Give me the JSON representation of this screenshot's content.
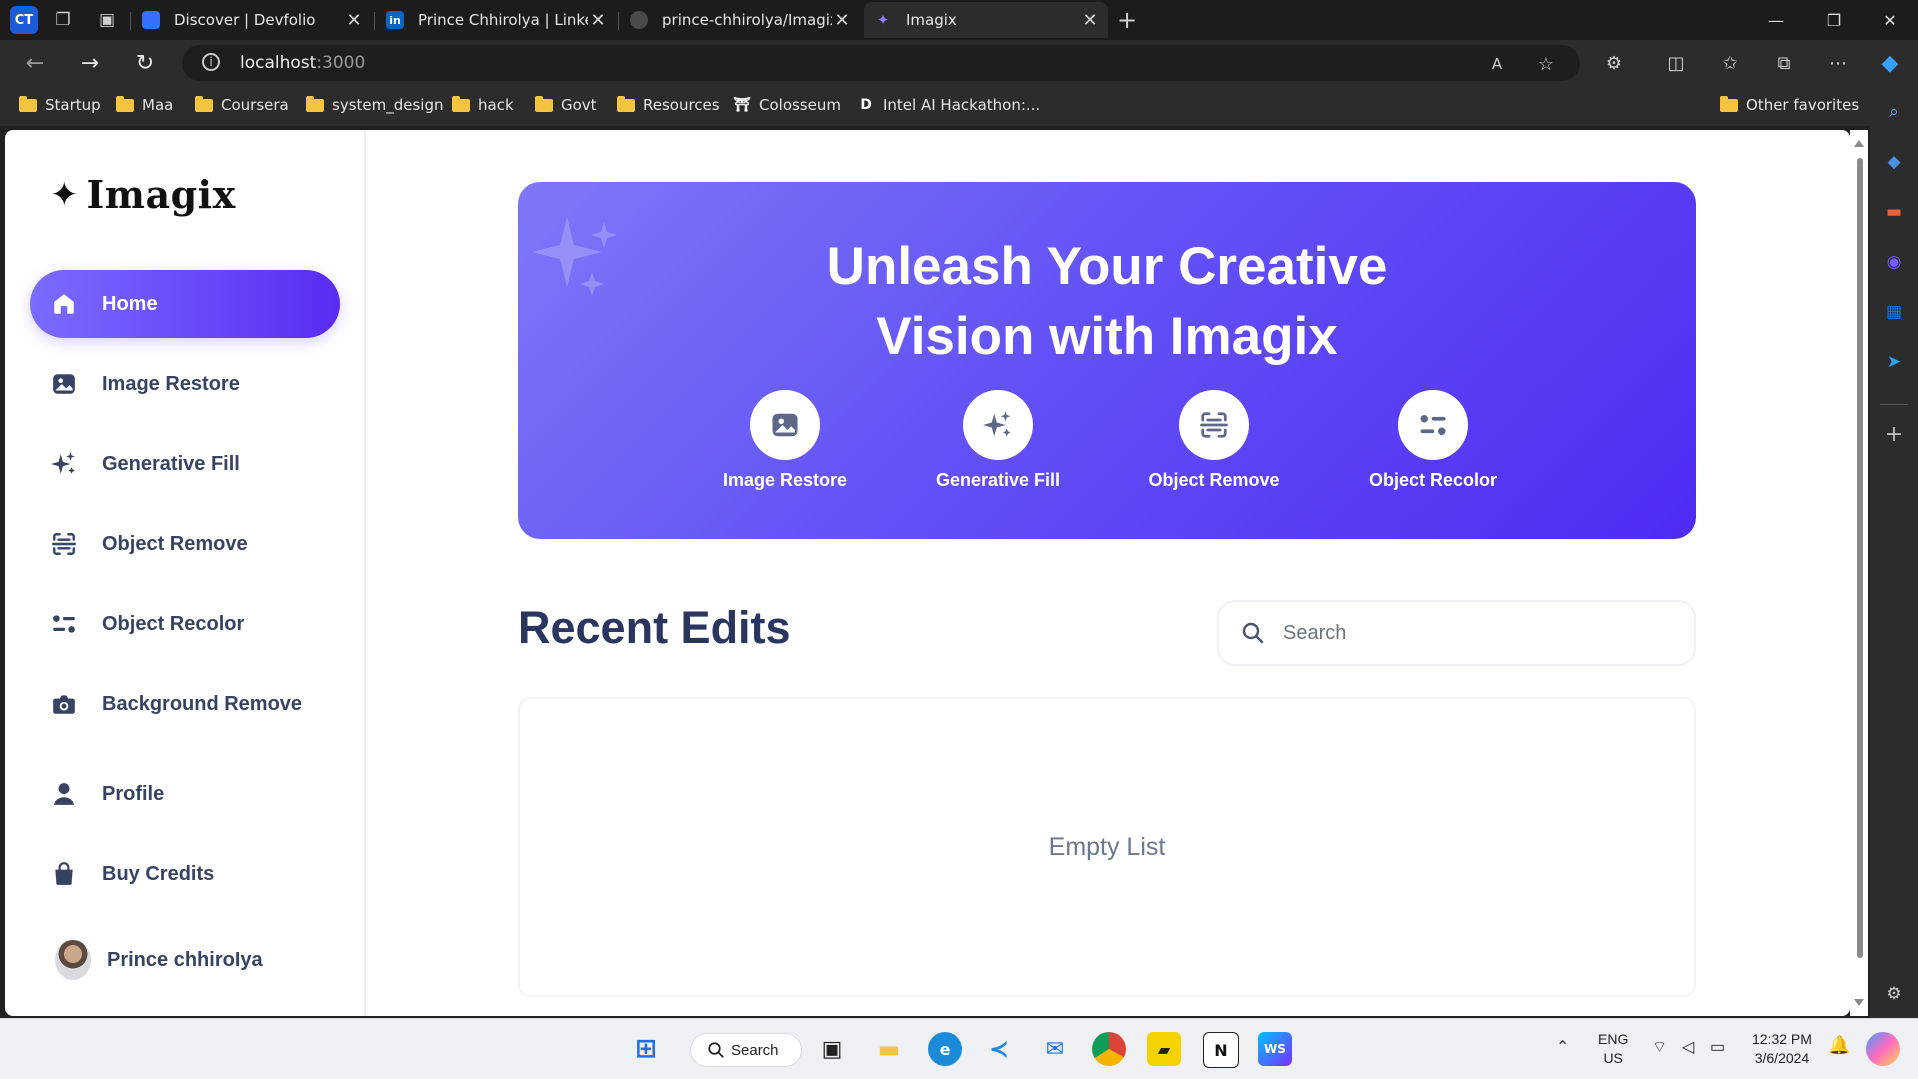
{
  "browser": {
    "profile_badge": "CT",
    "tabs": [
      {
        "label": "Discover | Devfolio",
        "favicon": "devfolio-icon"
      },
      {
        "label": "Prince Chhirolya | LinkedIn",
        "favicon": "linkedin-icon",
        "favicon_text": "in"
      },
      {
        "label": "prince-chhirolya/Imagix",
        "favicon": "github-icon"
      },
      {
        "label": "Imagix",
        "favicon": "imagix-icon",
        "active": true
      }
    ],
    "new_tab": "+",
    "address": {
      "host": "localhost",
      "port": ":3000"
    },
    "bookmarks": [
      {
        "label": "Startup",
        "type": "folder"
      },
      {
        "label": "Maa",
        "type": "folder"
      },
      {
        "label": "Coursera",
        "type": "folder"
      },
      {
        "label": "system_design",
        "type": "folder"
      },
      {
        "label": "hack",
        "type": "folder"
      },
      {
        "label": "Govt",
        "type": "folder"
      },
      {
        "label": "Resources",
        "type": "folder"
      },
      {
        "label": "Colosseum",
        "type": "site"
      },
      {
        "label": "Intel AI Hackathon:...",
        "type": "site",
        "glyph": "D"
      }
    ],
    "other_favorites": "Other favorites"
  },
  "app": {
    "logo": "Imagix",
    "nav": [
      {
        "label": "Home",
        "icon": "home-icon",
        "active": true
      },
      {
        "label": "Image Restore",
        "icon": "image-icon"
      },
      {
        "label": "Generative Fill",
        "icon": "stars-icon"
      },
      {
        "label": "Object Remove",
        "icon": "scan-icon"
      },
      {
        "label": "Object Recolor",
        "icon": "filter-icon"
      },
      {
        "label": "Background Remove",
        "icon": "camera-icon"
      },
      {
        "label": "Profile",
        "icon": "user-icon"
      },
      {
        "label": "Buy Credits",
        "icon": "bag-icon"
      }
    ],
    "user": {
      "name": "Prince chhiroIya"
    }
  },
  "hero": {
    "title_line1": "Unleash Your Creative",
    "title_line2": "Vision with Imagix",
    "tools": [
      {
        "label": "Image Restore",
        "icon": "image-icon"
      },
      {
        "label": "Generative Fill",
        "icon": "stars-icon"
      },
      {
        "label": "Object Remove",
        "icon": "scan-icon"
      },
      {
        "label": "Object Recolor",
        "icon": "filter-icon"
      }
    ]
  },
  "recent": {
    "title": "Recent Edits",
    "search_placeholder": "Search",
    "empty_text": "Empty List"
  },
  "taskbar": {
    "search_label": "Search",
    "lang_line1": "ENG",
    "lang_line2": "US",
    "time": "12:32 PM",
    "date": "3/6/2024"
  },
  "colors": {
    "accent": "#5a2cf3",
    "accent_light": "#7a6cff",
    "text_dark": "#2a3560",
    "nav_text": "#384262"
  }
}
